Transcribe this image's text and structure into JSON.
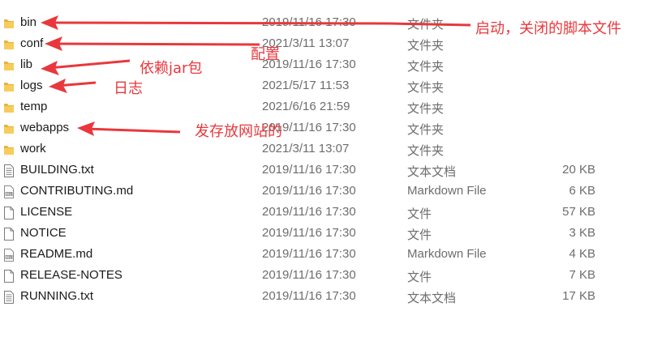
{
  "files": [
    {
      "name": "bin",
      "date": "2019/11/16 17:30",
      "type": "文件夹",
      "size": "",
      "icon": "folder-icon"
    },
    {
      "name": "conf",
      "date": "2021/3/11 13:07",
      "type": "文件夹",
      "size": "",
      "icon": "folder-icon"
    },
    {
      "name": "lib",
      "date": "2019/11/16 17:30",
      "type": "文件夹",
      "size": "",
      "icon": "folder-icon"
    },
    {
      "name": "logs",
      "date": "2021/5/17 11:53",
      "type": "文件夹",
      "size": "",
      "icon": "folder-icon"
    },
    {
      "name": "temp",
      "date": "2021/6/16 21:59",
      "type": "文件夹",
      "size": "",
      "icon": "folder-icon"
    },
    {
      "name": "webapps",
      "date": "2019/11/16 17:30",
      "type": "文件夹",
      "size": "",
      "icon": "folder-icon"
    },
    {
      "name": "work",
      "date": "2021/3/11 13:07",
      "type": "文件夹",
      "size": "",
      "icon": "folder-icon"
    },
    {
      "name": "BUILDING.txt",
      "date": "2019/11/16 17:30",
      "type": "文本文档",
      "size": "20 KB",
      "icon": "text-file-icon"
    },
    {
      "name": "CONTRIBUTING.md",
      "date": "2019/11/16 17:30",
      "type": "Markdown File",
      "size": "6 KB",
      "icon": "markdown-file-icon"
    },
    {
      "name": "LICENSE",
      "date": "2019/11/16 17:30",
      "type": "文件",
      "size": "57 KB",
      "icon": "file-icon"
    },
    {
      "name": "NOTICE",
      "date": "2019/11/16 17:30",
      "type": "文件",
      "size": "3 KB",
      "icon": "file-icon"
    },
    {
      "name": "README.md",
      "date": "2019/11/16 17:30",
      "type": "Markdown File",
      "size": "4 KB",
      "icon": "markdown-file-icon"
    },
    {
      "name": "RELEASE-NOTES",
      "date": "2019/11/16 17:30",
      "type": "文件",
      "size": "7 KB",
      "icon": "file-icon"
    },
    {
      "name": "RUNNING.txt",
      "date": "2019/11/16 17:30",
      "type": "文本文档",
      "size": "17 KB",
      "icon": "text-file-icon"
    }
  ],
  "annotations": {
    "color": "#e8383d",
    "bin": "启动，关闭的脚本文件",
    "conf": "配置",
    "lib": "依赖jar包",
    "logs": "日志",
    "webapps": "发存放网站的"
  },
  "colors": {
    "folder": "#f2c14e",
    "text": "#1a1a1a",
    "meta": "#6d6d6d"
  }
}
